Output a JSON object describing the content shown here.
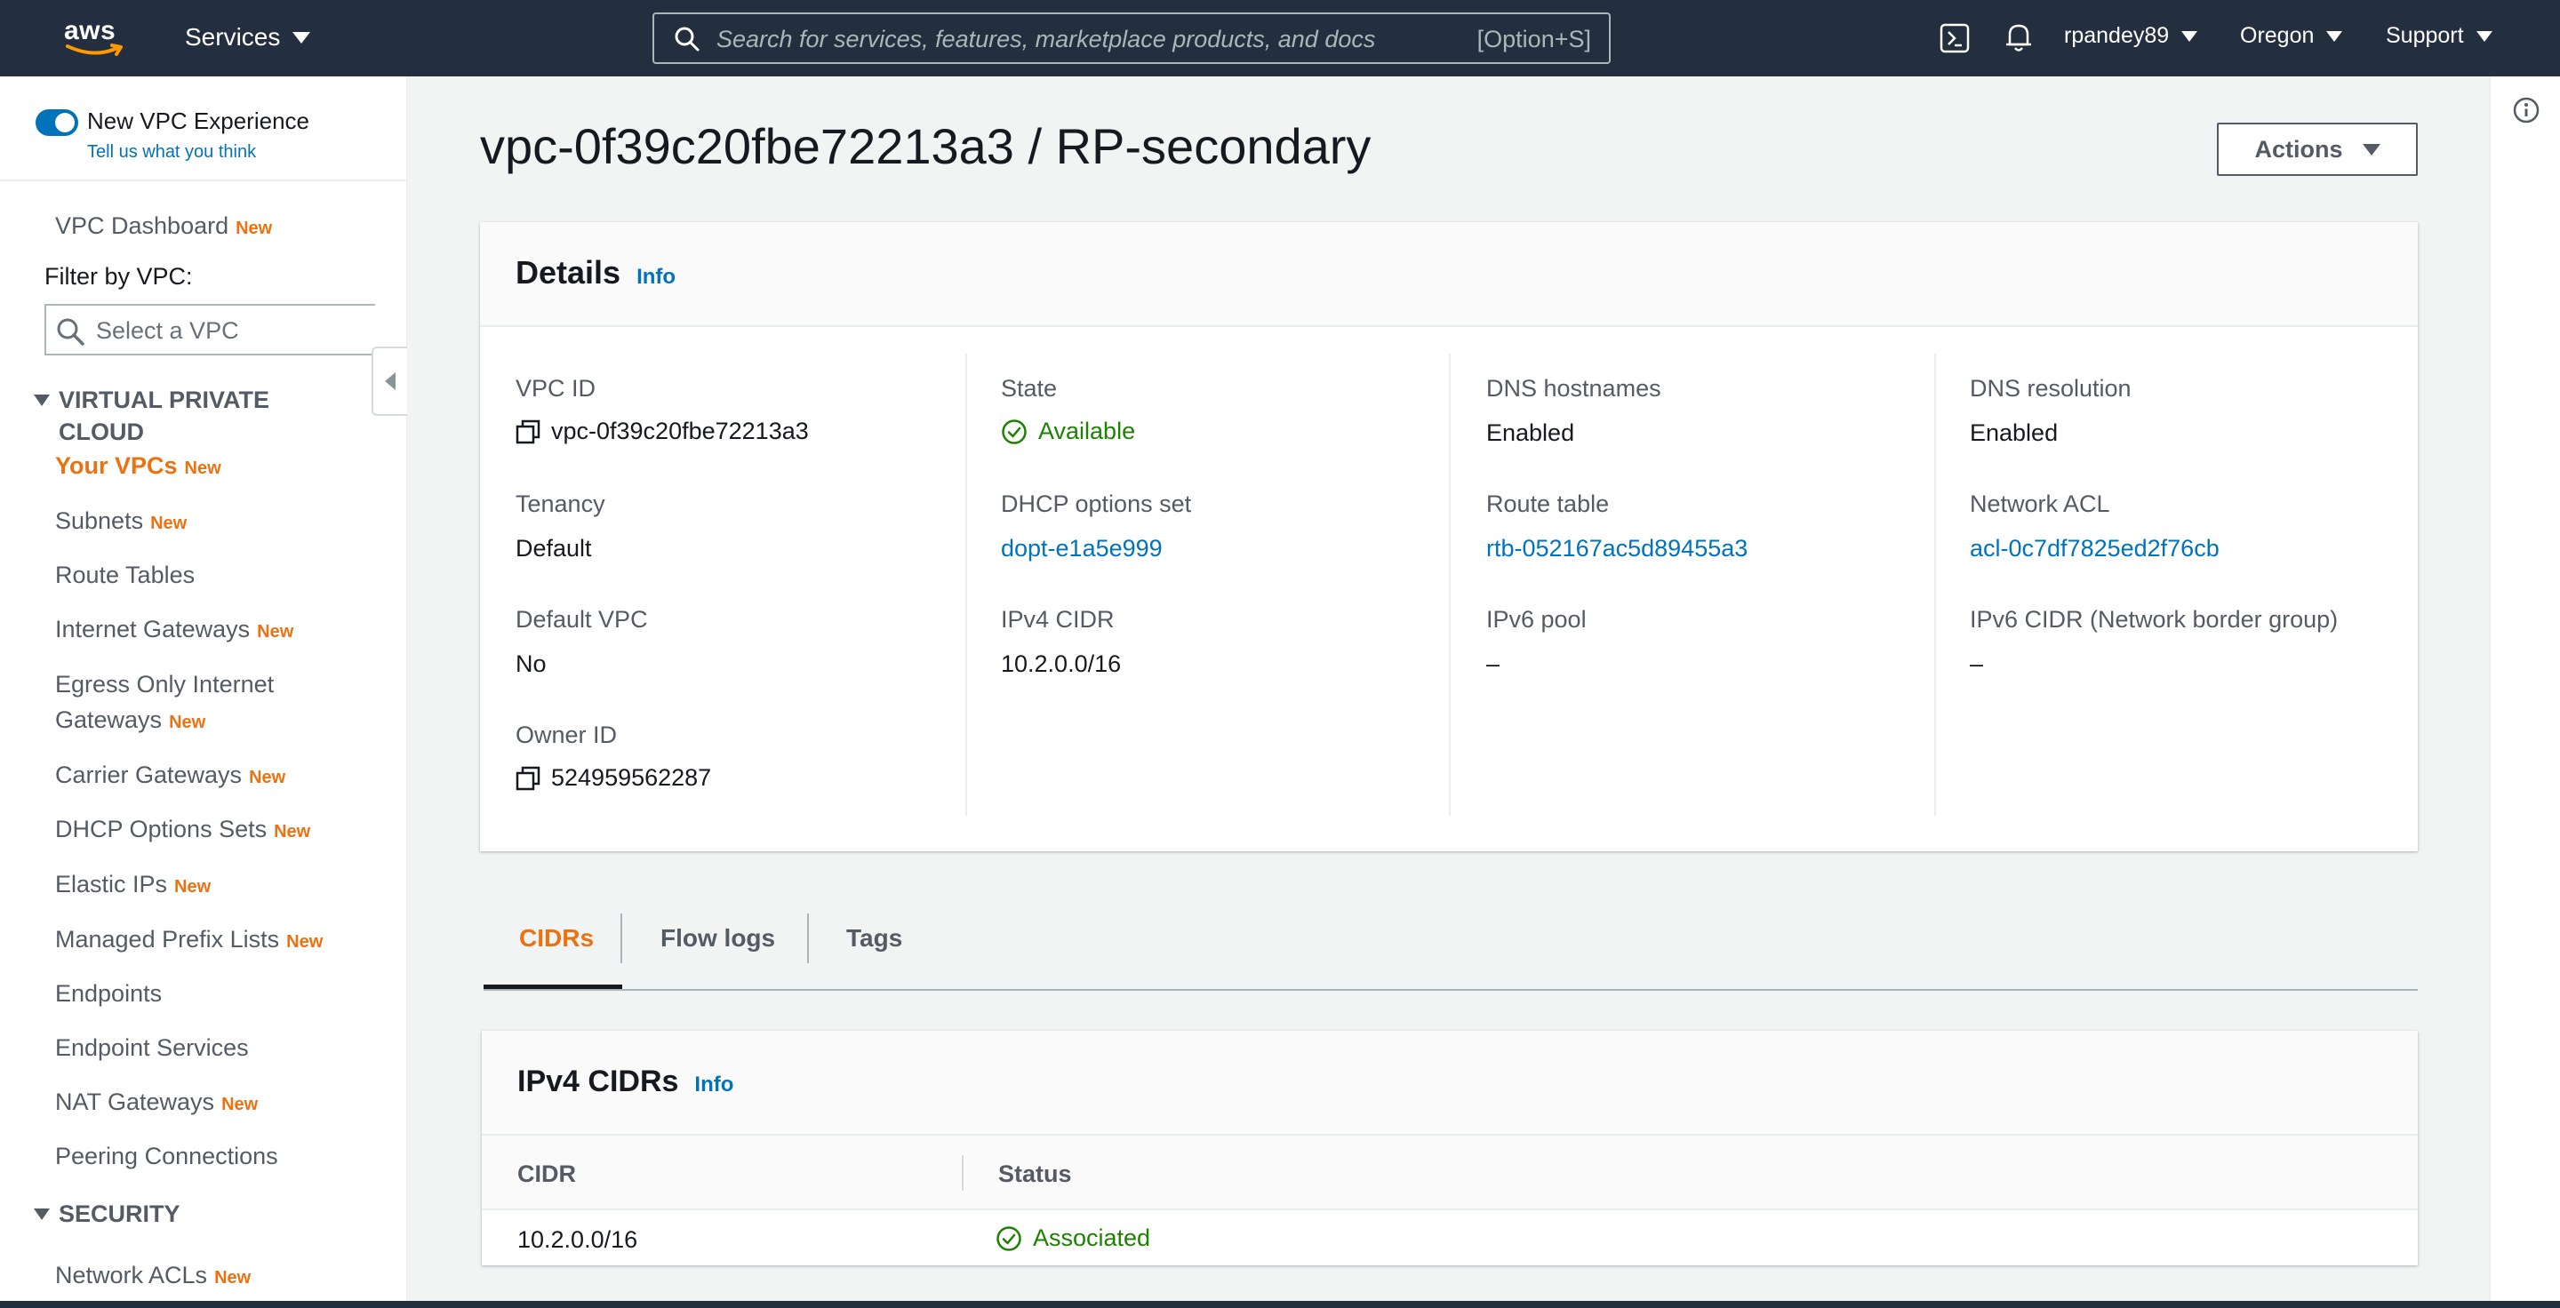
{
  "topnav": {
    "logo": "aws",
    "services_label": "Services",
    "search_placeholder": "Search for services, features, marketplace products, and docs",
    "search_shortcut": "[Option+S]",
    "user": "rpandey89",
    "region": "Oregon",
    "support": "Support"
  },
  "sidebar": {
    "toggle_label": "New VPC Experience",
    "feedback_link": "Tell us what you think",
    "dashboard": "VPC Dashboard",
    "new_badge": "New",
    "filter_label": "Filter by VPC:",
    "filter_placeholder": "Select a VPC",
    "section_vpc": "VIRTUAL PRIVATE CLOUD",
    "section_security": "SECURITY",
    "items": [
      {
        "label": "Your VPCs",
        "new": "New"
      },
      {
        "label": "Subnets",
        "new": "New"
      },
      {
        "label": "Route Tables",
        "new": ""
      },
      {
        "label": "Internet Gateways",
        "new": "New"
      },
      {
        "label": "Egress Only Internet",
        "label2": "Gateways",
        "new": "New"
      },
      {
        "label": "Carrier Gateways",
        "new": "New"
      },
      {
        "label": "DHCP Options Sets",
        "new": "New"
      },
      {
        "label": "Elastic IPs",
        "new": "New"
      },
      {
        "label": "Managed Prefix Lists",
        "new": "New"
      },
      {
        "label": "Endpoints",
        "new": ""
      },
      {
        "label": "Endpoint Services",
        "new": ""
      },
      {
        "label": "NAT Gateways",
        "new": "New"
      },
      {
        "label": "Peering Connections",
        "new": ""
      },
      {
        "label": "Network ACLs",
        "new": "New"
      }
    ]
  },
  "page": {
    "title": "vpc-0f39c20fbe72213a3 / RP-secondary",
    "actions_label": "Actions"
  },
  "details": {
    "title": "Details",
    "info": "Info",
    "vpc_id_label": "VPC ID",
    "vpc_id": "vpc-0f39c20fbe72213a3",
    "tenancy_label": "Tenancy",
    "tenancy": "Default",
    "default_vpc_label": "Default VPC",
    "default_vpc": "No",
    "owner_id_label": "Owner ID",
    "owner_id": "524959562287",
    "state_label": "State",
    "state": "Available",
    "dhcp_label": "DHCP options set",
    "dhcp": "dopt-e1a5e999",
    "ipv4_cidr_label": "IPv4 CIDR",
    "ipv4_cidr": "10.2.0.0/16",
    "dns_hostnames_label": "DNS hostnames",
    "dns_hostnames": "Enabled",
    "route_table_label": "Route table",
    "route_table": "rtb-052167ac5d89455a3",
    "ipv6_pool_label": "IPv6 pool",
    "ipv6_pool": "–",
    "dns_resolution_label": "DNS resolution",
    "dns_resolution": "Enabled",
    "network_acl_label": "Network ACL",
    "network_acl": "acl-0c7df7825ed2f76cb",
    "ipv6_cidr_label": "IPv6 CIDR (Network border group)",
    "ipv6_cidr": "–"
  },
  "tabs": {
    "cidrs": "CIDRs",
    "flow_logs": "Flow logs",
    "tags": "Tags"
  },
  "cidr_table": {
    "title": "IPv4 CIDRs",
    "info": "Info",
    "col_cidr": "CIDR",
    "col_status": "Status",
    "rows": [
      {
        "cidr": "10.2.0.0/16",
        "status": "Associated"
      }
    ]
  },
  "colors": {
    "nav_bg": "#232f3e",
    "accent_orange": "#ec7211",
    "link_blue": "#0073bb",
    "success_green": "#1d8102"
  },
  "icons": [
    "search-icon",
    "cloudshell-icon",
    "bell-icon",
    "copy-icon",
    "check-circle-icon",
    "info-circle-icon"
  ]
}
